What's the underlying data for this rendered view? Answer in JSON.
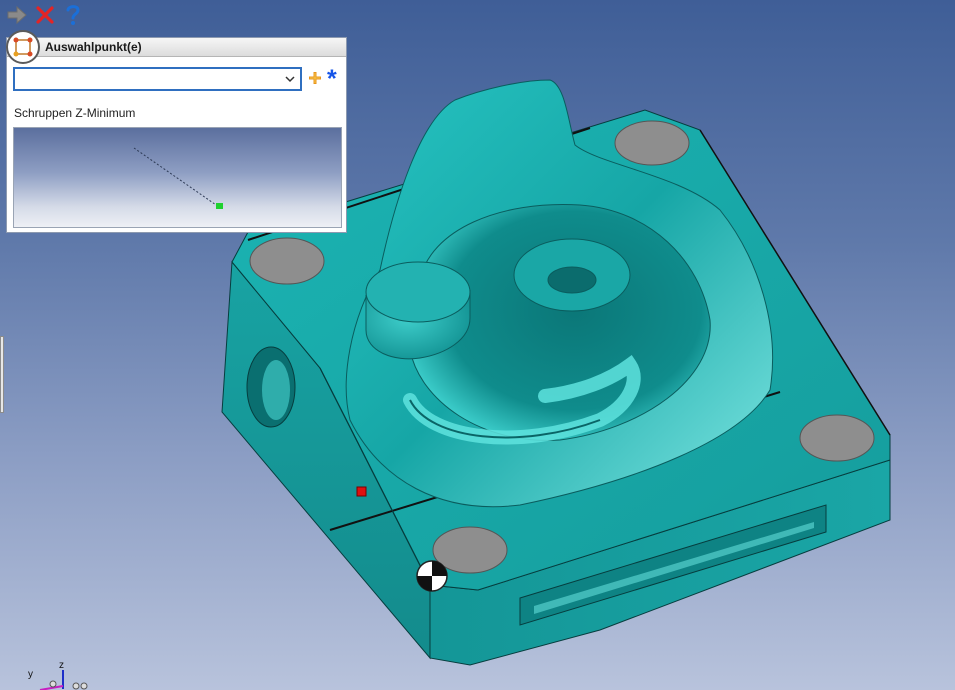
{
  "toolbar": {
    "apply_icon": "arrow-right-icon",
    "cancel_icon": "close-icon",
    "help_icon": "help-icon"
  },
  "dialog": {
    "title": "Auswahlpunkt(e)",
    "icon": "point-selection-icon",
    "combo_value": "",
    "add_icon": "add-point-icon",
    "all_icon": "asterisk-icon",
    "label": "Schruppen Z-Minimum"
  },
  "triad": {
    "y_label": "y",
    "z_label": "z"
  },
  "colors": {
    "model_face": "#1ea8a8",
    "model_dark": "#0b7f80",
    "hole": "#8e8e8e",
    "accent_blue": "#1655e8",
    "selection_red": "#e01010",
    "preview_point": "#1fd12f"
  }
}
